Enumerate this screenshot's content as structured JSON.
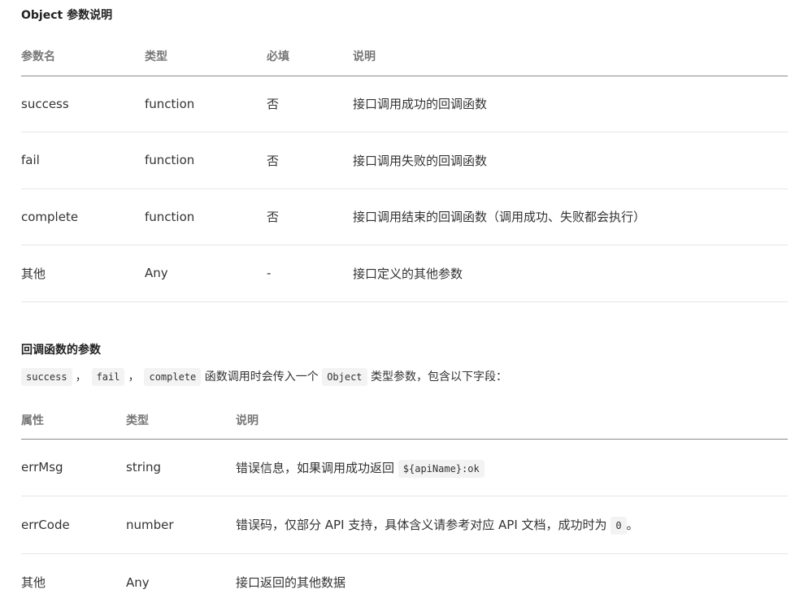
{
  "section1": {
    "title": "Object 参数说明",
    "headers": [
      "参数名",
      "类型",
      "必填",
      "说明"
    ],
    "rows": [
      {
        "name": "success",
        "type": "function",
        "required": "否",
        "desc": "接口调用成功的回调函数"
      },
      {
        "name": "fail",
        "type": "function",
        "required": "否",
        "desc": "接口调用失败的回调函数"
      },
      {
        "name": "complete",
        "type": "function",
        "required": "否",
        "desc": "接口调用结束的回调函数（调用成功、失败都会执行）"
      },
      {
        "name": "其他",
        "type": "Any",
        "required": "-",
        "desc": "接口定义的其他参数"
      }
    ]
  },
  "section2": {
    "title": "回调函数的参数",
    "desc": {
      "code1": "success",
      "sep1": "，",
      "code2": "fail",
      "sep2": "，",
      "code3": "complete",
      "text1": " 函数调用时会传入一个 ",
      "code4": "Object",
      "text2": " 类型参数，包含以下字段："
    },
    "headers": [
      "属性",
      "类型",
      "说明"
    ],
    "rows": [
      {
        "name": "errMsg",
        "type": "string",
        "desc_text": "错误信息，如果调用成功返回 ",
        "desc_code": "${apiName}:ok",
        "desc_tail": ""
      },
      {
        "name": "errCode",
        "type": "number",
        "desc_text": "错误码，仅部分 API 支持，具体含义请参考对应 API 文档，成功时为 ",
        "desc_code": "0",
        "desc_tail": "。"
      },
      {
        "name": "其他",
        "type": "Any",
        "desc_text": "接口返回的其他数据",
        "desc_code": "",
        "desc_tail": ""
      }
    ]
  }
}
